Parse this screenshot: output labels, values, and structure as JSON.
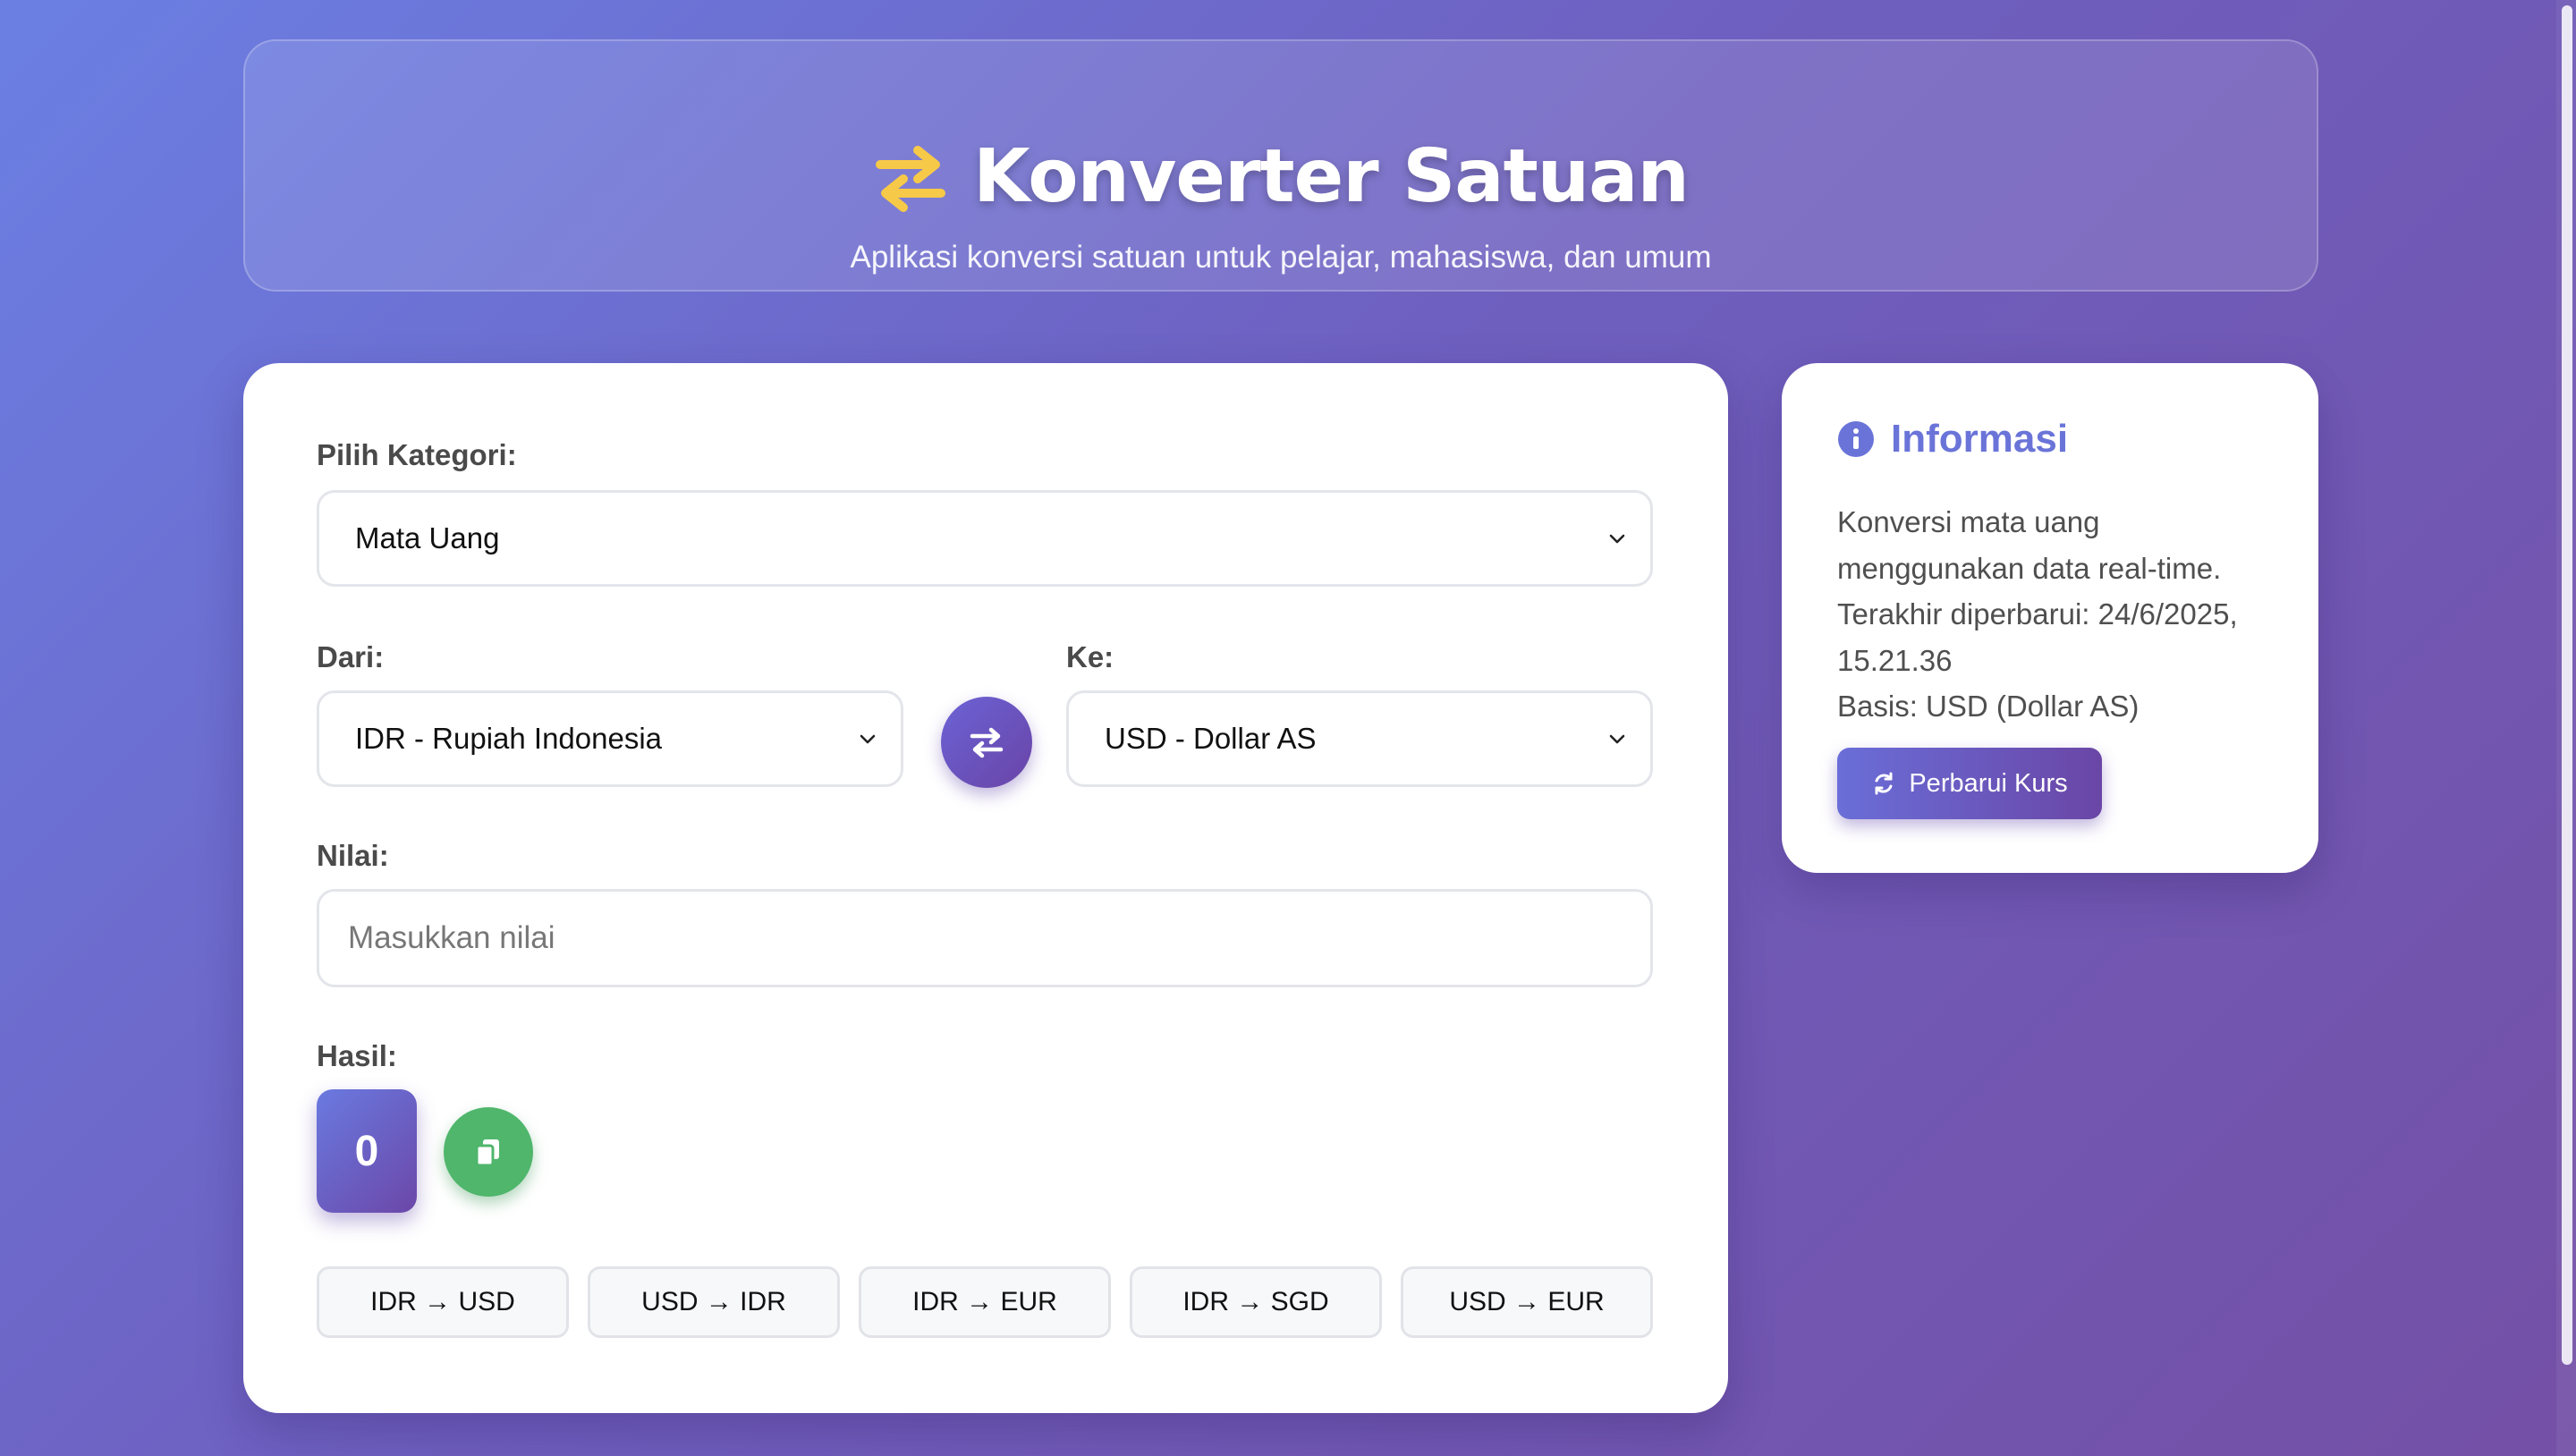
{
  "header": {
    "title": "Konverter Satuan",
    "subtitle": "Aplikasi konversi satuan untuk pelajar, mahasiswa, dan umum",
    "icon": "exchange-arrows-icon"
  },
  "converter": {
    "category_label": "Pilih Kategori:",
    "category_value": "Mata Uang",
    "from_label": "Dari:",
    "from_value": "IDR - Rupiah Indonesia",
    "to_label": "Ke:",
    "to_value": "USD - Dollar AS",
    "value_label": "Nilai:",
    "value_placeholder": "Masukkan nilai",
    "value": "",
    "result_label": "Hasil:",
    "result_value": "0",
    "quick_buttons": [
      {
        "label": "IDR → USD"
      },
      {
        "label": "USD → IDR"
      },
      {
        "label": "IDR → EUR"
      },
      {
        "label": "IDR → SGD"
      },
      {
        "label": "USD → EUR"
      }
    ]
  },
  "info": {
    "title": "Informasi",
    "lines": [
      "Konversi mata uang",
      "menggunakan data real-time.",
      "Terakhir diperbarui: 24/6/2025,",
      "15.21.36",
      "Basis: USD (Dollar AS)"
    ],
    "refresh_label": "Perbarui Kurs"
  },
  "colors": {
    "accent": "#6a74d8",
    "gradient_start": "#6b7fe3",
    "gradient_end": "#7450a6",
    "copy_green": "#4fb66c",
    "icon_yellow": "#f7c948"
  }
}
